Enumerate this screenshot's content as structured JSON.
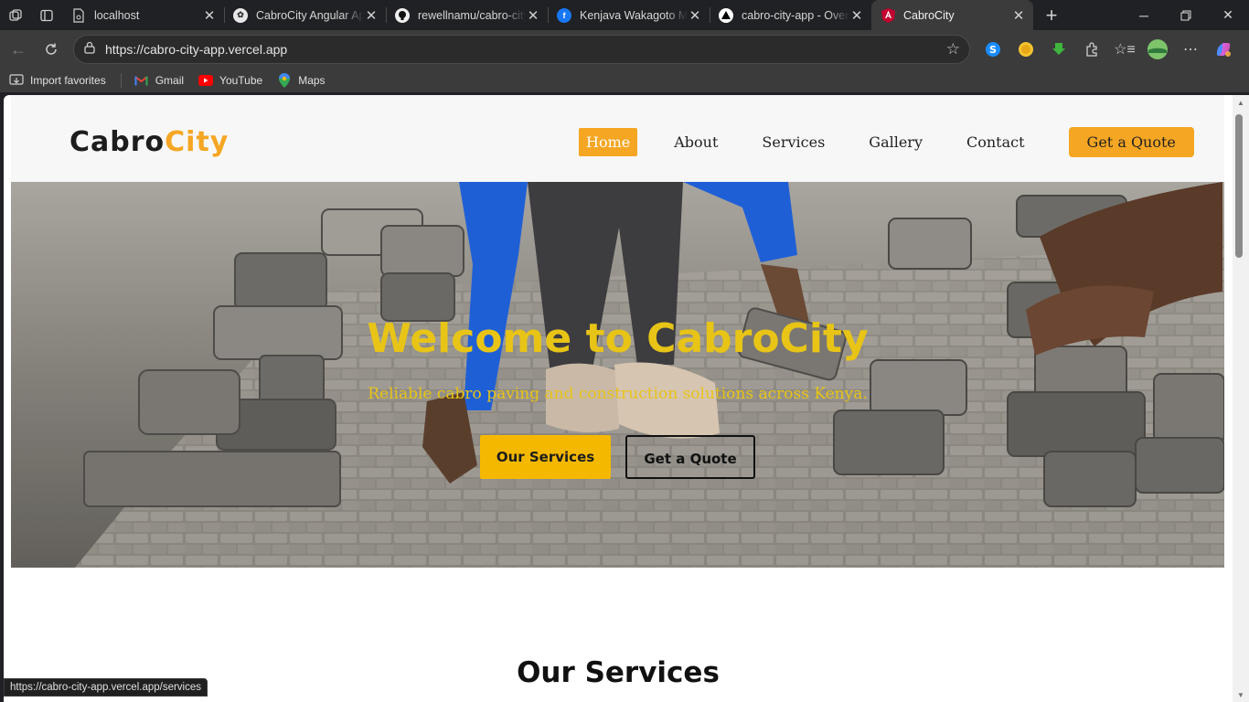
{
  "browser": {
    "tabs": [
      {
        "title": "localhost",
        "icon": "page-icon",
        "active": false
      },
      {
        "title": "CabroCity Angular App",
        "icon": "chatgpt-icon",
        "active": false
      },
      {
        "title": "rewellnamu/cabro-city",
        "icon": "github-icon",
        "active": false
      },
      {
        "title": "Kenjava Wakagoto Mu",
        "icon": "facebook-icon",
        "active": false
      },
      {
        "title": "cabro-city-app - Overview",
        "icon": "vercel-icon",
        "active": false
      },
      {
        "title": "CabroCity",
        "icon": "angular-icon",
        "active": true
      }
    ],
    "url": "https://cabro-city-app.vercel.app",
    "bookmarks": [
      {
        "label": "Import favorites",
        "icon": "import-icon"
      },
      {
        "label": "Gmail",
        "icon": "gmail-icon"
      },
      {
        "label": "YouTube",
        "icon": "youtube-icon"
      },
      {
        "label": "Maps",
        "icon": "maps-icon"
      }
    ],
    "status_url": "https://cabro-city-app.vercel.app/services"
  },
  "site": {
    "logo_part1": "Cabro",
    "logo_part2": "City",
    "nav": [
      "Home",
      "About",
      "Services",
      "Gallery",
      "Contact"
    ],
    "nav_active": "Home",
    "quote_button": "Get a Quote",
    "hero": {
      "title": "Welcome to CabroCity",
      "subtitle": "Reliable cabro paving and construction solutions across Kenya.",
      "primary_button": "Our Services",
      "secondary_button": "Get a Quote"
    },
    "section_title": "Our Services"
  },
  "colors": {
    "accent": "#f5a623",
    "hero_text": "#e8c416",
    "browser_chrome": "#202124"
  }
}
